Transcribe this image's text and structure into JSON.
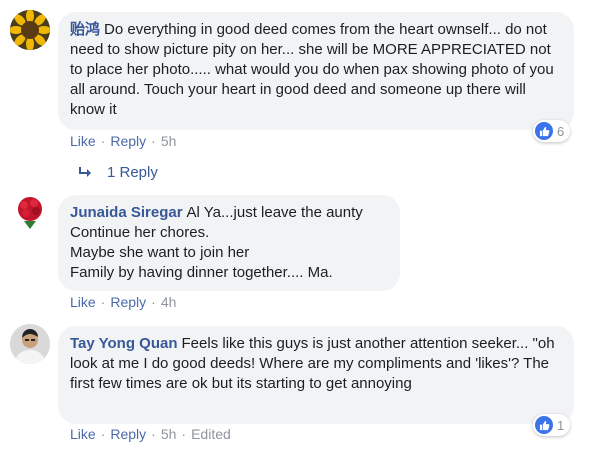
{
  "comments": [
    {
      "author": "贻鸿",
      "text": "Do everything in good deed comes from the heart ownself... do not need to show picture pity on her... she will be MORE APPRECIATED not to place her photo..... what would you do when pax showing photo of you all around. Touch your heart in good deed and someone up there will know it",
      "actions": {
        "like": "Like",
        "reply": "Reply",
        "time": "5h"
      },
      "reaction_count": "6",
      "replies_link": "1 Reply"
    },
    {
      "author": "Junaida Siregar",
      "lines": [
        "Al Ya...just leave the aunty",
        "Continue her chores.",
        "Maybe she want to join her",
        "Family by having dinner together.... Ma."
      ],
      "actions": {
        "like": "Like",
        "reply": "Reply",
        "time": "4h"
      }
    },
    {
      "author": "Tay Yong Quan",
      "text": "Feels like this guys is just another attention seeker... \"oh look at me I do good deeds! Where are my compliments and 'likes'? The first few times are ok but its starting to get annoying",
      "actions": {
        "like": "Like",
        "reply": "Reply",
        "time": "5h",
        "edited": "Edited"
      },
      "reaction_count": "1"
    }
  ],
  "colors": {
    "author": "#385898",
    "link": "#4b6aa8",
    "meta": "#90949c",
    "bubble": "#f2f3f5",
    "like_badge": "#3b73e8"
  },
  "icons": {
    "reply_arrow": "reply-arrow-icon",
    "like": "like-icon"
  }
}
